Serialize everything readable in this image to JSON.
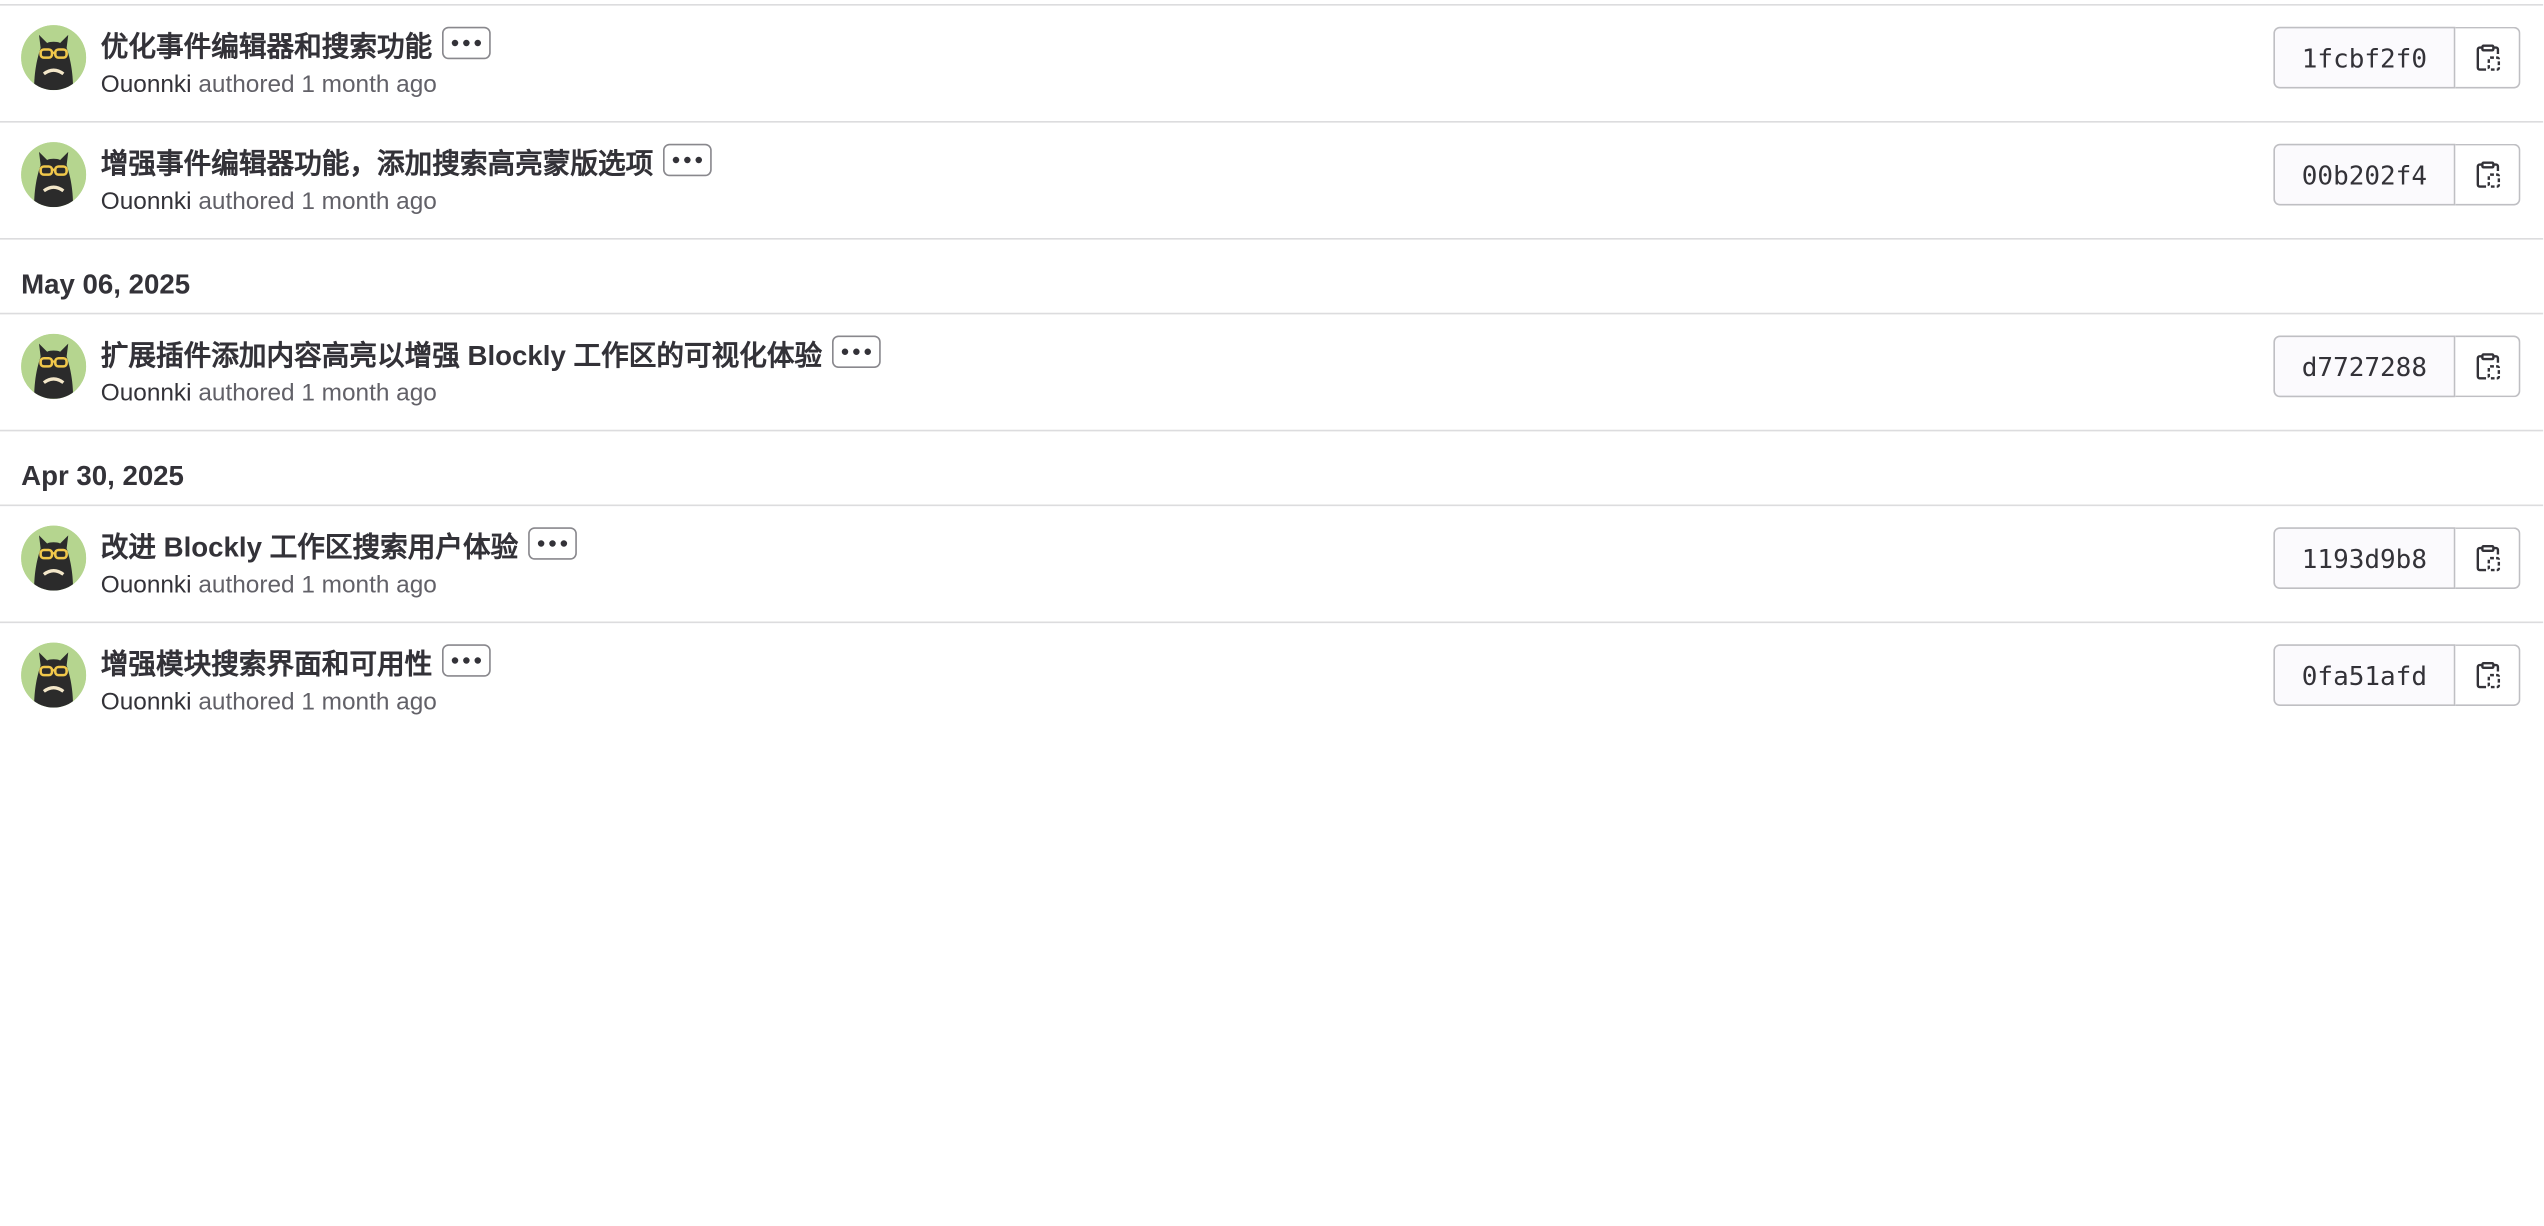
{
  "groups": [
    {
      "date": "",
      "commits": [
        {
          "title": "优化事件编辑器和搜索功能",
          "author": "Ouonnki",
          "action": "authored",
          "time": "1 month ago",
          "sha": "1fcbf2f0"
        },
        {
          "title": "增强事件编辑器功能，添加搜索高亮蒙版选项",
          "author": "Ouonnki",
          "action": "authored",
          "time": "1 month ago",
          "sha": "00b202f4"
        }
      ]
    },
    {
      "date": "May 06, 2025",
      "commits": [
        {
          "title": "扩展插件添加内容高亮以增强 Blockly 工作区的可视化体验",
          "author": "Ouonnki",
          "action": "authored",
          "time": "1 month ago",
          "sha": "d7727288"
        }
      ]
    },
    {
      "date": "Apr 30, 2025",
      "commits": [
        {
          "title": "改进 Blockly 工作区搜索用户体验",
          "author": "Ouonnki",
          "action": "authored",
          "time": "1 month ago",
          "sha": "1193d9b8"
        },
        {
          "title": "增强模块搜索界面和可用性",
          "author": "Ouonnki",
          "action": "authored",
          "time": "1 month ago",
          "sha": "0fa51afd"
        }
      ]
    }
  ],
  "icons": {
    "ellipsis": "ellipsis-icon",
    "copy": "copy-clipboard-icon",
    "avatar": "cat-with-sunglasses-avatar"
  },
  "colors": {
    "avatar_bg": "#b5d58f",
    "text": "#333238",
    "muted": "#626168",
    "border": "#dcdcde"
  }
}
